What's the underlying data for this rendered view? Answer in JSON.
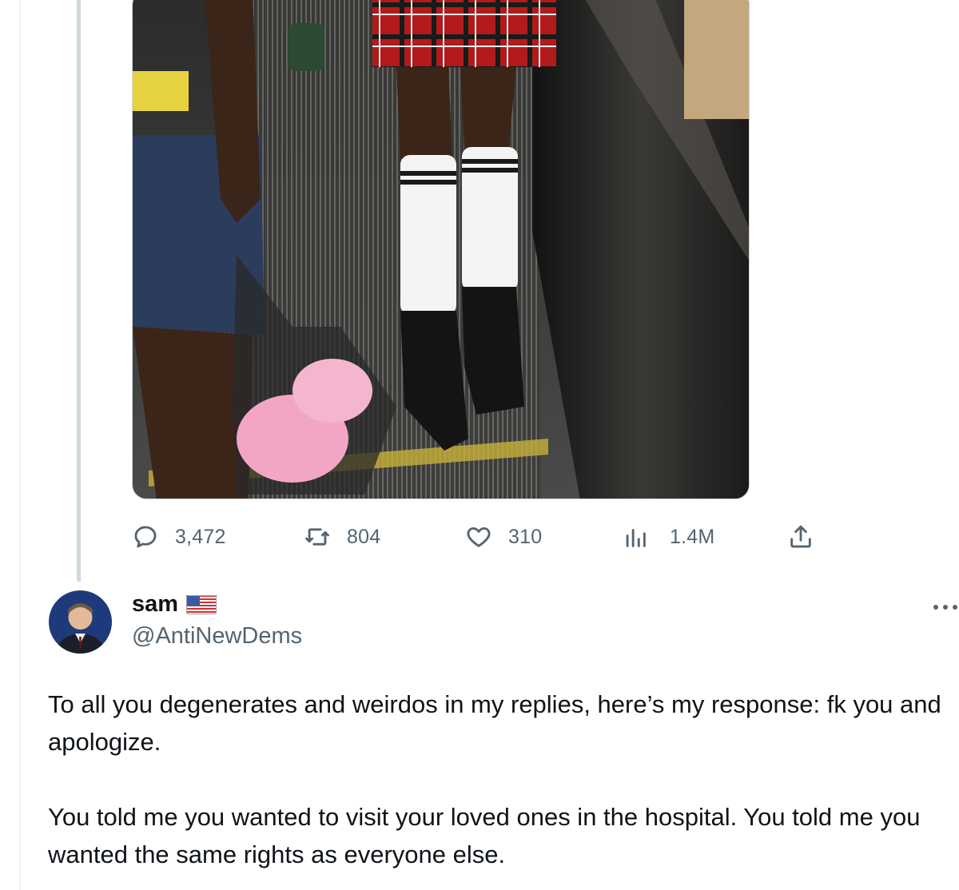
{
  "quoted_tweet": {
    "media": {
      "description_icon": "photo-escalator"
    },
    "metrics": {
      "replies": "3,472",
      "retweets": "804",
      "likes": "310",
      "views": "1.4M"
    }
  },
  "reply_tweet": {
    "author": {
      "display_name": "sam",
      "handle": "@AntiNewDems",
      "badge_icon": "us-flag-icon"
    },
    "text_paragraphs": [
      "To all you degenerates and weirdos in my replies, here’s my response: fk you and apologize.",
      "You told me you wanted to visit your loved ones in the hospital. You told me you wanted the same rights as everyone else."
    ]
  },
  "colors": {
    "secondary_text": "#536471",
    "primary_text": "#0f1419",
    "thread_line": "#cfd9de"
  }
}
